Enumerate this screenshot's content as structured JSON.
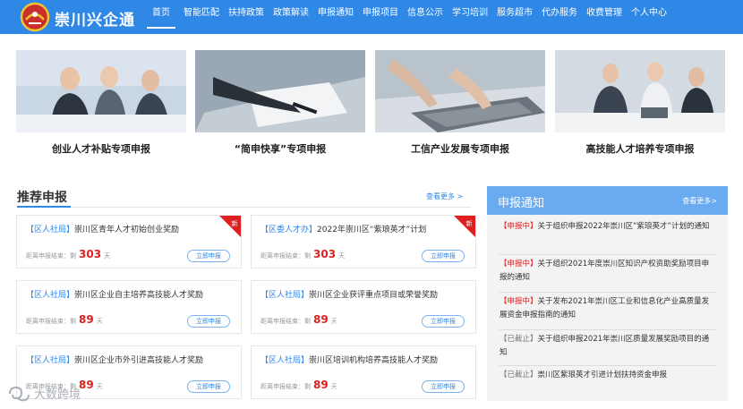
{
  "header": {
    "brand": "崇川兴企通",
    "nav": [
      "首页",
      "智能匹配",
      "扶持政策",
      "政策解读",
      "申报通知",
      "申报项目",
      "信息公示",
      "学习培训",
      "服务超市",
      "代办服务",
      "收费管理",
      "个人中心"
    ],
    "active_index": 0,
    "accent": "#2f87e6"
  },
  "banners": [
    {
      "caption": "创业人才补贴专项申报"
    },
    {
      "caption": "“简申快享”专项申报"
    },
    {
      "caption": "工信产业发展专项申报"
    },
    {
      "caption": "高技能人才培养专项申报"
    }
  ],
  "recommend": {
    "title": "推荐申报",
    "more": "查看更多 >",
    "deadline_prefix": "距离申报结束：剩",
    "days_unit": "天",
    "apply_label": "立即申报",
    "new_label": "新",
    "cards": [
      {
        "tag": "【区人社局】",
        "title": "崇川区青年人才初始创业奖励",
        "days": "303",
        "is_new": true
      },
      {
        "tag": "【区委人才办】",
        "title": "2022年崇川区“紫琅英才”计划",
        "days": "303",
        "is_new": true
      },
      {
        "tag": "【区人社局】",
        "title": "崇川区企业自主培养高技能人才奖励",
        "days": "89",
        "is_new": false
      },
      {
        "tag": "【区人社局】",
        "title": "崇川区企业获评重点项目或荣誉奖励",
        "days": "89",
        "is_new": false
      },
      {
        "tag": "【区人社局】",
        "title": "崇川区企业市外引进高技能人才奖励",
        "days": "89",
        "is_new": false
      },
      {
        "tag": "【区人社局】",
        "title": "崇川区培训机构培养高技能人才奖励",
        "days": "89",
        "is_new": false
      }
    ]
  },
  "notice": {
    "title": "申报通知",
    "more": "查看更多>",
    "items": [
      {
        "status": "【申报中】",
        "text": "关于组织申报2022年崇川区“紫琅英才”计划的通知"
      },
      {
        "status": "【申报中】",
        "text": "关于组织2021年度崇川区知识产权资助奖励项目申报的通知"
      },
      {
        "status": "【申报中】",
        "text": "关于发布2021年崇川区工业和信息化产业高质量发展资金申报指南的通知"
      },
      {
        "status": "【已截止】",
        "text": "关于组织申报2021年崇川区质量发展奖励项目的通知"
      },
      {
        "status": "【已截止】",
        "text": "崇川区紫琅英才引进计划扶持资金申报"
      }
    ]
  },
  "watermark": "大数跨境"
}
